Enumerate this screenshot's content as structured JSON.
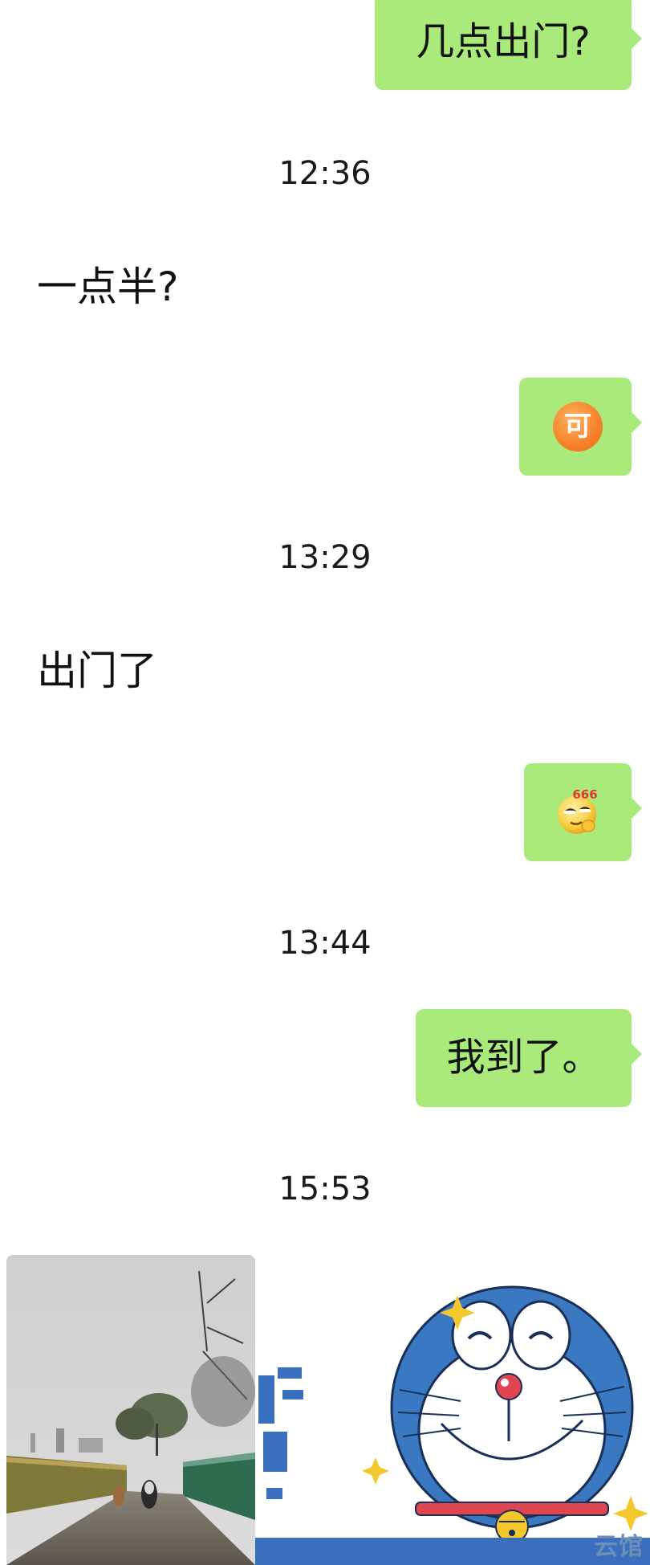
{
  "messages": [
    {
      "type": "outgoing",
      "text": "几点出门?"
    },
    {
      "type": "timestamp",
      "text": "12:36"
    },
    {
      "type": "incoming",
      "text": "一点半?"
    },
    {
      "type": "outgoing-emoji",
      "emoji": "ke-emoji",
      "text": "可"
    },
    {
      "type": "timestamp",
      "text": "13:29"
    },
    {
      "type": "incoming",
      "text": "出门了"
    },
    {
      "type": "outgoing-emoji",
      "emoji": "666-emoji",
      "text": "666"
    },
    {
      "type": "timestamp",
      "text": "13:44"
    },
    {
      "type": "outgoing",
      "text": "我到了。"
    },
    {
      "type": "timestamp",
      "text": "15:53"
    }
  ],
  "attachments": {
    "photo": "photo",
    "sticker": "doraemon-sticker",
    "watermark": "云馆"
  },
  "colors": {
    "outgoing_bubble": "#a9ea7a",
    "background": "#ffffff",
    "emoji_orange": "#f6812a",
    "doraemon_blue": "#3a6fbd"
  }
}
